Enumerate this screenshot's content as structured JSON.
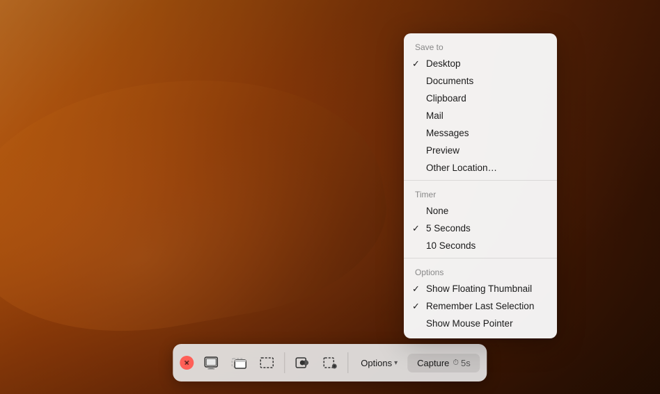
{
  "desktop": {
    "bg_description": "macOS Mojave desert dune wallpaper"
  },
  "dropdown": {
    "save_to_label": "Save to",
    "items_save": [
      {
        "label": "Desktop",
        "checked": true
      },
      {
        "label": "Documents",
        "checked": false
      },
      {
        "label": "Clipboard",
        "checked": false
      },
      {
        "label": "Mail",
        "checked": false
      },
      {
        "label": "Messages",
        "checked": false
      },
      {
        "label": "Preview",
        "checked": false
      },
      {
        "label": "Other Location…",
        "checked": false
      }
    ],
    "timer_label": "Timer",
    "items_timer": [
      {
        "label": "None",
        "checked": false
      },
      {
        "label": "5 Seconds",
        "checked": true
      },
      {
        "label": "10 Seconds",
        "checked": false
      }
    ],
    "options_label": "Options",
    "items_options": [
      {
        "label": "Show Floating Thumbnail",
        "checked": true
      },
      {
        "label": "Remember Last Selection",
        "checked": true
      },
      {
        "label": "Show Mouse Pointer",
        "checked": false
      }
    ]
  },
  "toolbar": {
    "close_label": "×",
    "capture_fullscreen_label": "Capture Entire Screen",
    "capture_window_label": "Capture Selected Window",
    "capture_selection_label": "Capture Selected Portion",
    "record_screen_label": "Record Entire Screen",
    "record_selection_label": "Record Selected Portion",
    "options_label": "Options",
    "options_chevron": "▾",
    "capture_label": "Capture",
    "timer_icon": "⏱",
    "timer_value": "5s"
  }
}
